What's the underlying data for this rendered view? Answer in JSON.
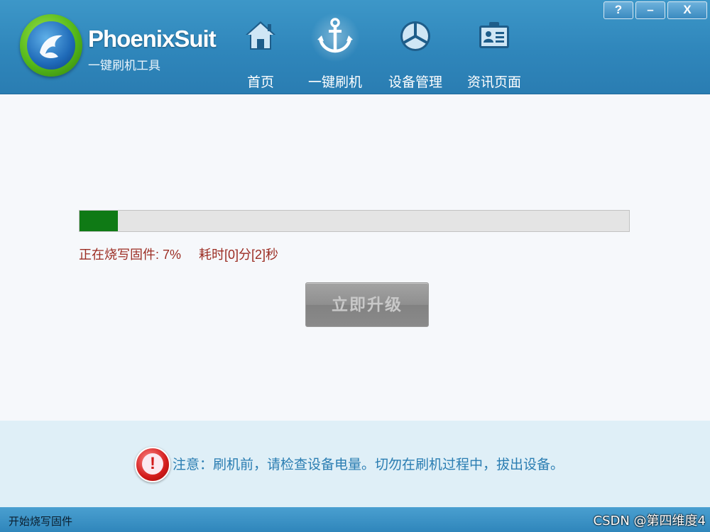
{
  "header": {
    "brand_name": "PhoenixSuit",
    "brand_subtitle": "一键刷机工具",
    "nav": [
      {
        "label": "首页",
        "icon": "home-icon",
        "active": false
      },
      {
        "label": "一键刷机",
        "icon": "anchor-icon",
        "active": true
      },
      {
        "label": "设备管理",
        "icon": "device-management-icon",
        "active": false
      },
      {
        "label": "资讯页面",
        "icon": "news-card-icon",
        "active": false
      }
    ],
    "window_buttons": {
      "help": "?",
      "minimize": "–",
      "close": "X"
    }
  },
  "main": {
    "progress_percent": 7,
    "status_text": "正在烧写固件: 7%     耗时[0]分[2]秒",
    "upgrade_button_label": "立即升级",
    "upgrade_button_enabled": false
  },
  "notice": {
    "icon": "warning-icon",
    "text": "注意：刷机前，请检查设备电量。切勿在刷机过程中，拔出设备。"
  },
  "statusbar": {
    "text": "开始烧写固件",
    "watermark": "CSDN @第四维度4"
  },
  "colors": {
    "header_blue": "#2f86bb",
    "progress_green": "#0f7a15",
    "status_red": "#9c2d23",
    "notice_blue": "#2a7db2"
  }
}
